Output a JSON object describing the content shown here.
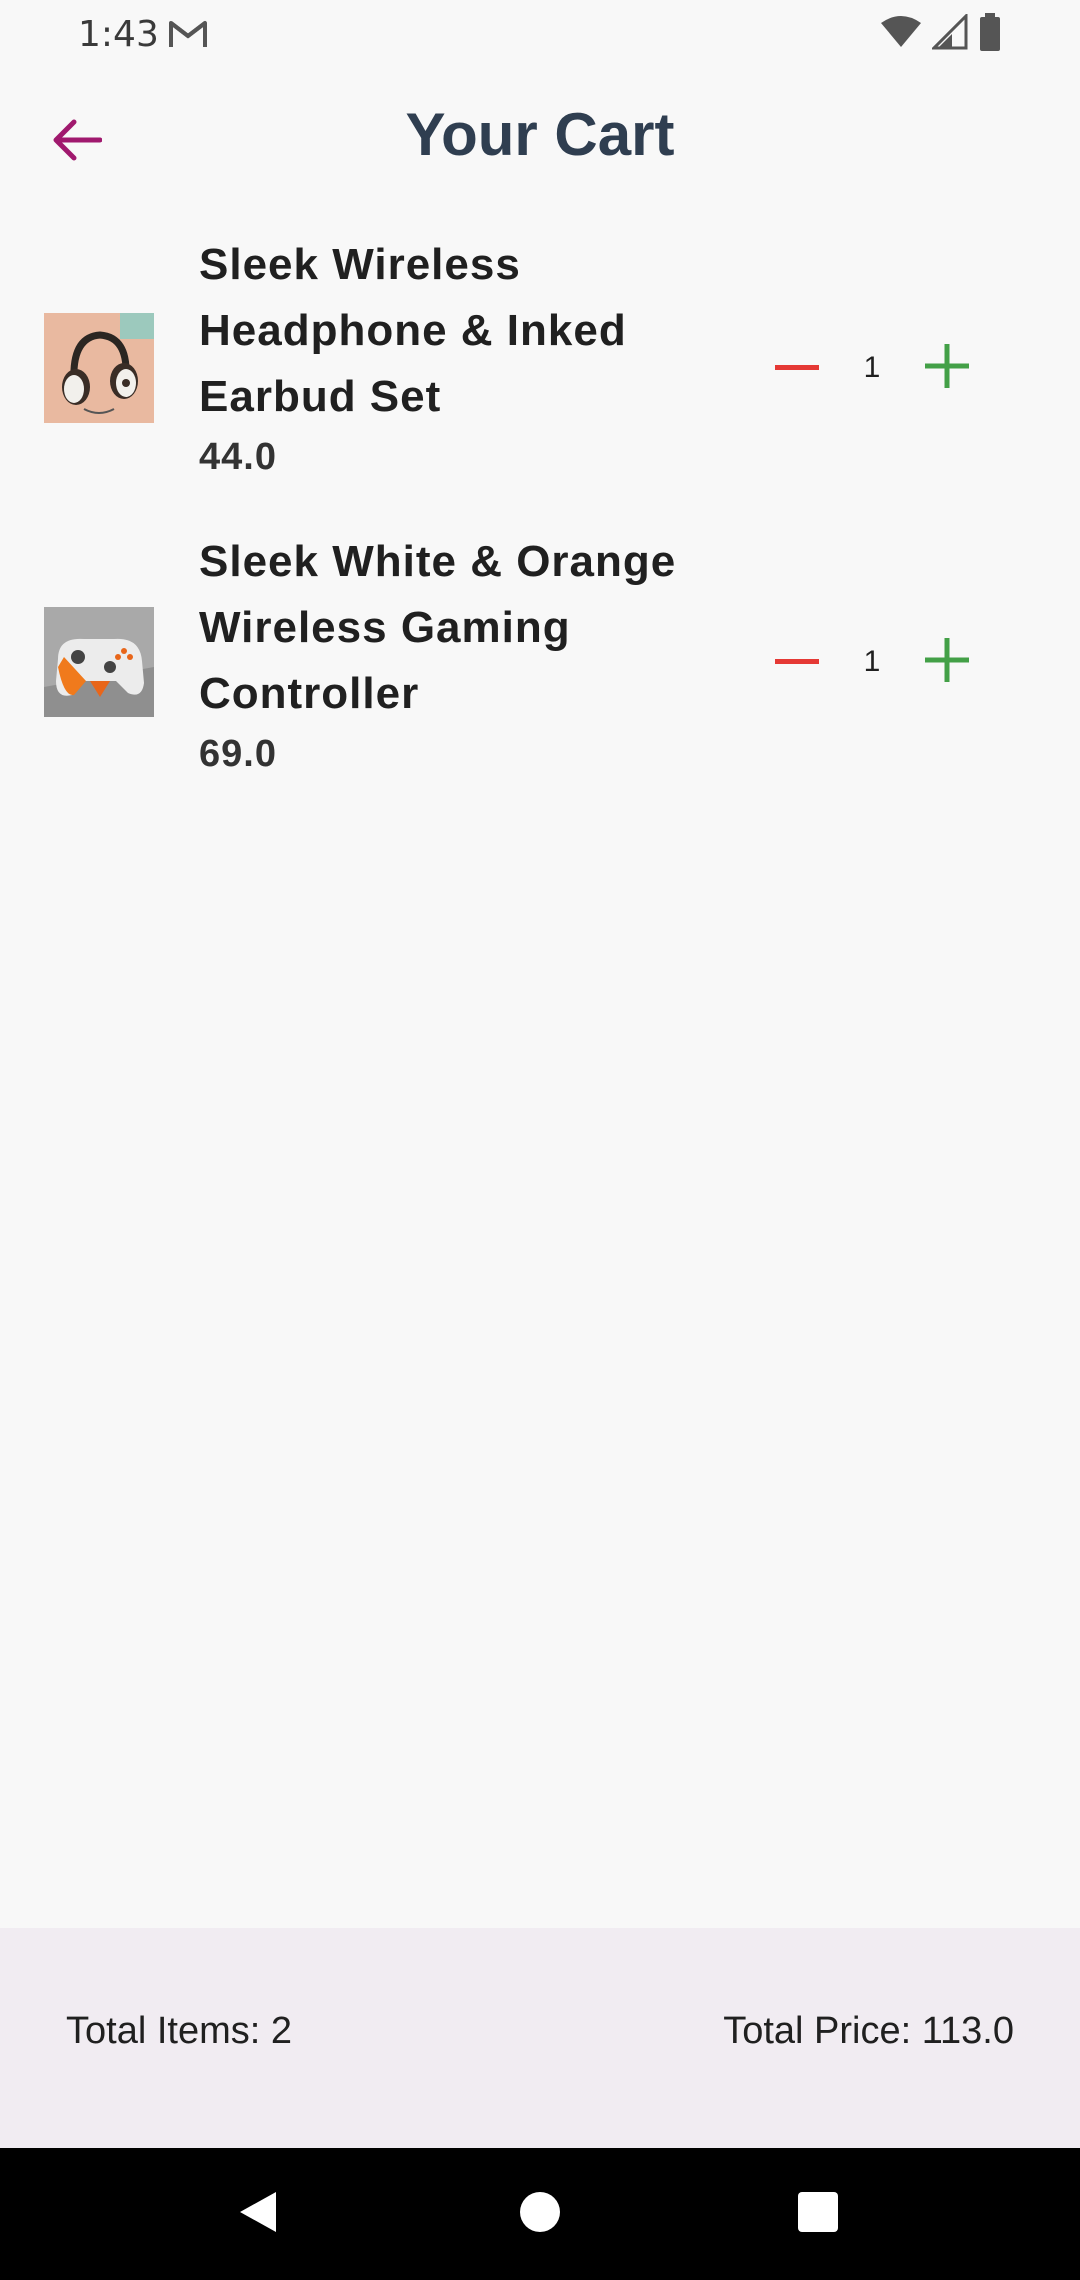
{
  "status_bar": {
    "time": "1:43",
    "icons": [
      "gmail-icon",
      "wifi-icon",
      "signal-icon",
      "battery-icon"
    ]
  },
  "app_bar": {
    "title": "Your Cart",
    "back_icon": "arrow-back-icon",
    "accent_color": "#a0196e"
  },
  "cart": {
    "items": [
      {
        "name": "Sleek Wireless Headphone & Inked Earbud Set",
        "price": "44.0",
        "quantity": "1",
        "thumb": "headphones-image"
      },
      {
        "name": "Sleek White & Orange Wireless Gaming Controller",
        "price": "69.0",
        "quantity": "1",
        "thumb": "gaming-controller-image"
      }
    ],
    "minus_color": "#e53935",
    "plus_color": "#43a047"
  },
  "summary": {
    "total_items": "Total Items: 2",
    "total_price": "Total Price: 113.0"
  },
  "nav_bar": {
    "buttons": [
      "back-triangle-icon",
      "home-circle-icon",
      "recents-square-icon"
    ]
  }
}
